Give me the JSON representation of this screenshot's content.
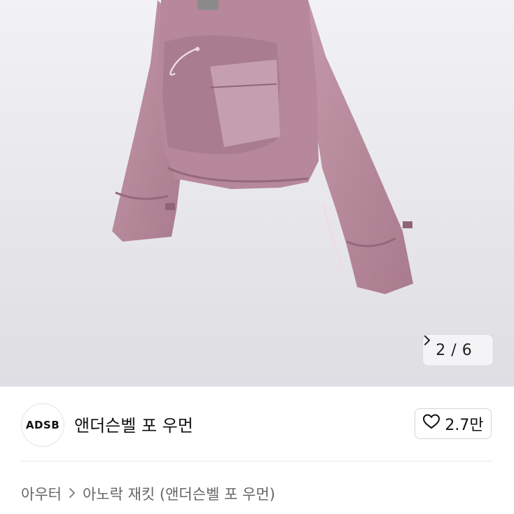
{
  "gallery": {
    "current_page": "2",
    "separator": "/",
    "total_pages": "6",
    "next_icon": "chevron-right-icon"
  },
  "brand": {
    "logo_text": "ADSB",
    "name": "앤더슨벨 포 우먼"
  },
  "like": {
    "icon": "heart-outline-icon",
    "count": "2.7만"
  },
  "breadcrumb": {
    "category": "아우터",
    "separator_icon": "chevron-right-icon",
    "product": "아노락 재킷 (앤더슨벨 포 우먼)"
  },
  "colors": {
    "jacket": "#b98a9b",
    "background": "#e9e9ec",
    "text_muted": "#666666"
  }
}
